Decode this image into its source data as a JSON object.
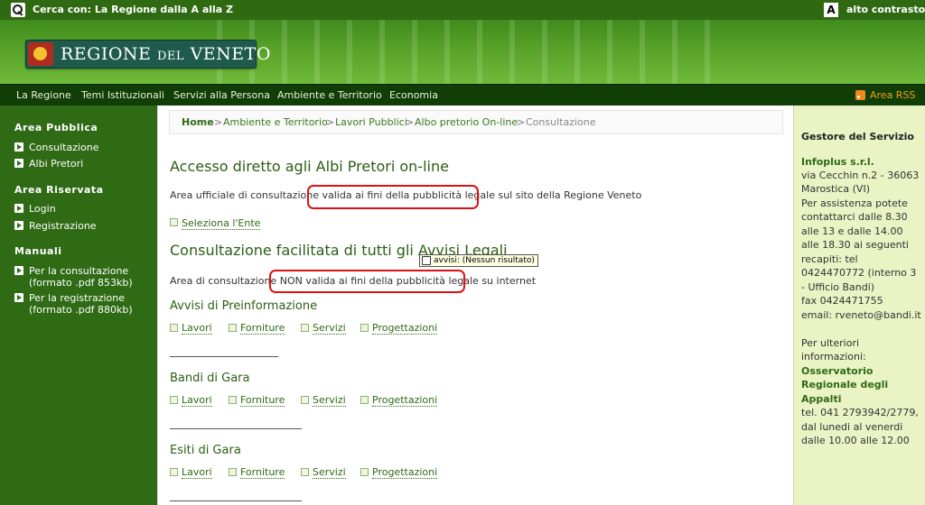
{
  "topbar": {
    "search_text": "Cerca con: La Regione dalla A alla Z",
    "contrast_label": "alto contrasto"
  },
  "banner": {
    "logo_main": "REGIONE ",
    "logo_small": "DEL",
    "logo_end": " VENETO"
  },
  "nav": {
    "items": [
      "La Regione",
      "Temi Istituzionali",
      "Servizi alla Persona",
      "Ambiente e Territorio",
      "Economia"
    ],
    "rss": "Area RSS"
  },
  "sidebar": {
    "area_pubblica": {
      "title": "Area Pubblica",
      "items": [
        "Consultazione",
        "Albi Pretori"
      ]
    },
    "area_riservata": {
      "title": "Area Riservata",
      "items": [
        "Login",
        "Registrazione"
      ]
    },
    "manuali": {
      "title": "Manuali",
      "items": [
        {
          "line1": "Per la consultazione",
          "line2": "(formato .pdf 853kb)"
        },
        {
          "line1": "Per la registrazione",
          "line2": "(formato .pdf 880kb)"
        }
      ]
    }
  },
  "breadcrumb": {
    "home": "Home",
    "sep": ">",
    "items": [
      "Ambiente e Territorio",
      "Lavori Pubblici",
      "Albo pretorio On-line"
    ],
    "current": "Consultazione"
  },
  "main": {
    "section1": {
      "title": "Accesso diretto agli Albi Pretori on-line",
      "para_before": "Area ufficiale di consultazione ",
      "para_highlight": "valida ai fini della pubblicità legale",
      "para_after": " sul sito della Regione Veneto",
      "select_link": "Seleziona l'Ente"
    },
    "section2": {
      "title": "Consultazione facilitata di tutti gli Avvisi Legali",
      "para_before": "Area di consultazione ",
      "para_highlight": "NON valida ai fini della pubblicità legale",
      "para_after": " su internet"
    },
    "tooltip": "avvisi: (Nessun risultato)",
    "categories": [
      {
        "title": "Avvisi di Preinformazione",
        "links": [
          "Lavori",
          "Forniture",
          "Servizi",
          "Progettazioni"
        ]
      },
      {
        "title": "Bandi di Gara",
        "links": [
          "Lavori",
          "Forniture",
          "Servizi",
          "Progettazioni"
        ]
      },
      {
        "title": "Esiti di Gara",
        "links": [
          "Lavori",
          "Forniture",
          "Servizi",
          "Progettazioni"
        ]
      }
    ]
  },
  "rightbar": {
    "title": "Gestore del Servizio",
    "company": "Infoplus s.r.l.",
    "lines1": [
      "via Cecchin n.2 - 36063",
      "Marostica (VI)",
      "Per assistenza potete",
      "contattarci dalle 8.30",
      "alle 13 e dalle 14.00",
      "alle 18.30 ai seguenti",
      "recapiti: tel",
      "0424470772 (interno 3",
      "- Ufficio Bandi)",
      "fax 0424471755",
      "email: rveneto@bandi.it"
    ],
    "lines2": [
      "Per ulteriori",
      "informazioni:"
    ],
    "org": [
      "Osservatorio",
      "Regionale degli",
      "Appalti"
    ],
    "lines3": [
      "tel. 041 2793942/2779,",
      "dal lunedi al venerdi",
      "dalle 10.00 alle 12.00"
    ]
  },
  "colors": {
    "nav_bg": "#113d06",
    "sidebar_bg": "#2f6a15",
    "accent": "#2b5e14",
    "rightbar_bg": "#e9f3c4",
    "highlight_box": "#dd1111"
  }
}
